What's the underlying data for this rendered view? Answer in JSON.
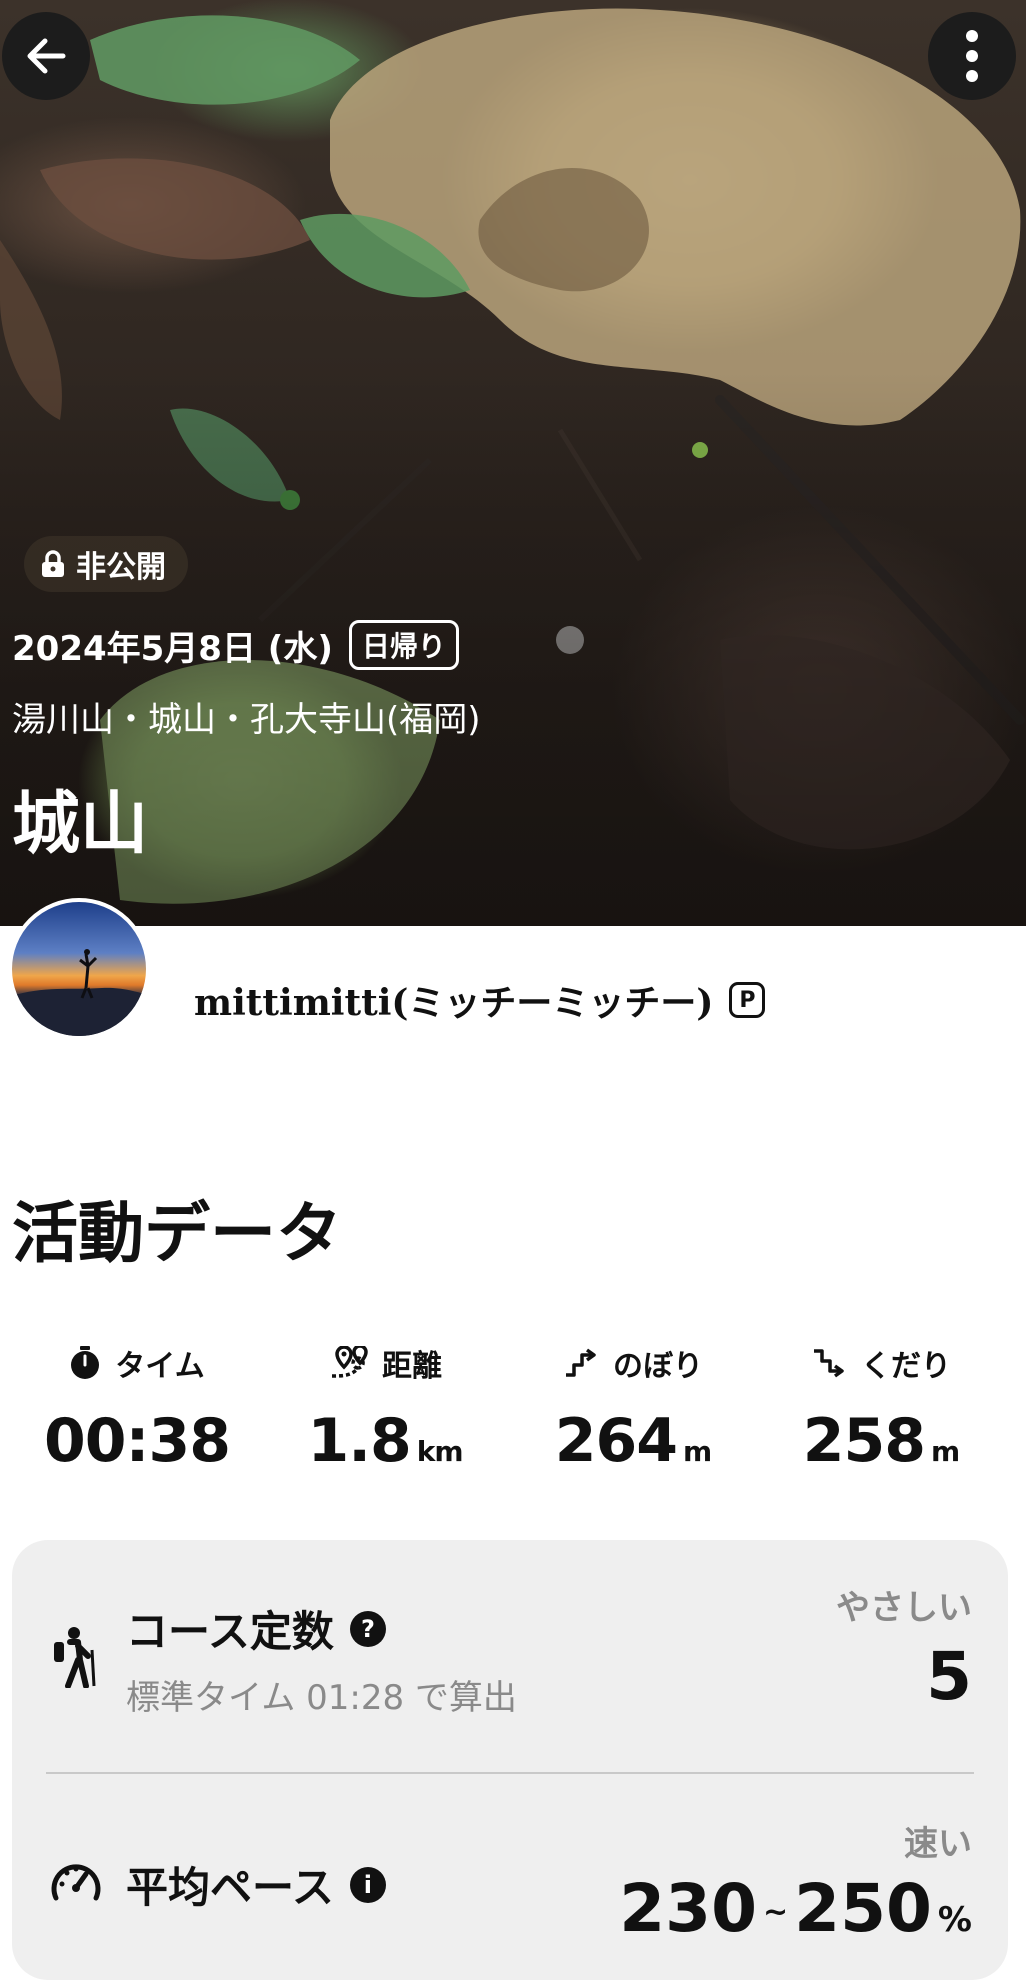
{
  "header": {
    "back_icon": "arrow-left-icon",
    "more_icon": "more-vertical-icon",
    "privacy_label": "非公開",
    "date": "2024年5月8日 (水)",
    "trip_type": "日帰り",
    "area": "湯川山・城山・孔大寺山(福岡)",
    "title": "城山"
  },
  "user": {
    "name": "mittimitti(ミッチーミッチー)",
    "badge": "P"
  },
  "activity": {
    "section_title": "活動データ",
    "stats": [
      {
        "label": "タイム",
        "icon": "stopwatch-icon",
        "value": "00:38",
        "unit": ""
      },
      {
        "label": "距離",
        "icon": "route-pin-icon",
        "value": "1.8",
        "unit": "km"
      },
      {
        "label": "のぼり",
        "icon": "ascent-icon",
        "value": "264",
        "unit": "m"
      },
      {
        "label": "くだり",
        "icon": "descent-icon",
        "value": "258",
        "unit": "m"
      }
    ]
  },
  "course": {
    "label": "コース定数",
    "help": "?",
    "sub": "標準タイム 01:28 で算出",
    "level": "やさしい",
    "value": "5"
  },
  "pace": {
    "label": "平均ペース",
    "info": "i",
    "level": "速い",
    "min": "230",
    "tilde": "~",
    "max": "250",
    "unit": "%"
  },
  "colors": {
    "text": "#111111",
    "muted": "#8a8a8a",
    "card_bg": "#efefef",
    "button_bg": "#1c1c1c"
  }
}
